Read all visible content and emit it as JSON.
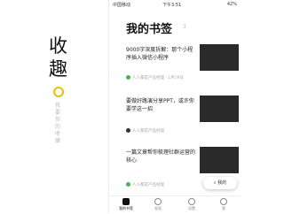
{
  "left": {
    "brand_line1": "收",
    "brand_line2": "趣",
    "vertical_text": "我要你的收藏"
  },
  "status": {
    "carrier": "中国移动",
    "time": "下午3:51",
    "battery": "42%"
  },
  "header": {
    "title": "我的书签",
    "count": "3"
  },
  "cards": [
    {
      "title": "9000字深度拆解：那个小程序插入微信小程序",
      "source": "人人都是产品经理 · 1月19日"
    },
    {
      "title": "要做好路演分享PPT，或许你要学这一招",
      "source": "人人都是产品经理"
    },
    {
      "title": "一篇文章帮你梳理社群运营的核心",
      "source": "人人都是产品经理"
    }
  ],
  "fab": {
    "label": "我的"
  },
  "tabs": [
    {
      "label": "我的书签"
    },
    {
      "label": "发现"
    },
    {
      "label": "设置"
    },
    {
      "label": "我"
    }
  ]
}
